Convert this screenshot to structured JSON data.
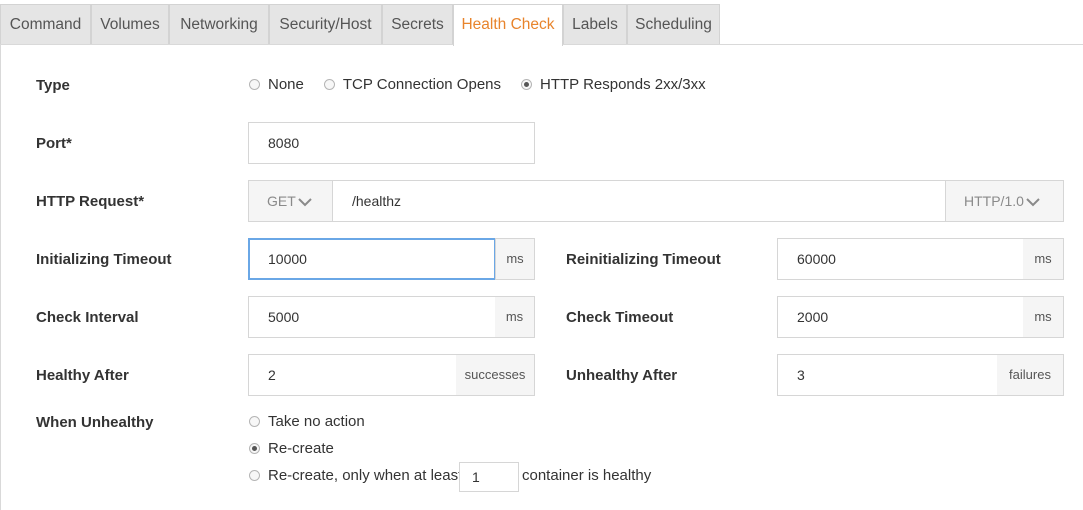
{
  "tabs": [
    {
      "label": "Command"
    },
    {
      "label": "Volumes"
    },
    {
      "label": "Networking"
    },
    {
      "label": "Security/Host"
    },
    {
      "label": "Secrets"
    },
    {
      "label": "Health Check",
      "active": true
    },
    {
      "label": "Labels"
    },
    {
      "label": "Scheduling"
    }
  ],
  "type": {
    "label": "Type",
    "options": [
      "None",
      "TCP Connection Opens",
      "HTTP Responds 2xx/3xx"
    ],
    "selected": "HTTP Responds 2xx/3xx"
  },
  "port": {
    "label": "Port*",
    "value": "8080"
  },
  "http_request": {
    "label": "HTTP Request*",
    "method": "GET",
    "path": "/healthz",
    "version": "HTTP/1.0"
  },
  "initializing_timeout": {
    "label": "Initializing Timeout",
    "value": "10000",
    "unit": "ms"
  },
  "reinitializing_timeout": {
    "label": "Reinitializing Timeout",
    "value": "60000",
    "unit": "ms"
  },
  "check_interval": {
    "label": "Check Interval",
    "value": "5000",
    "unit": "ms"
  },
  "check_timeout": {
    "label": "Check Timeout",
    "value": "2000",
    "unit": "ms"
  },
  "healthy_after": {
    "label": "Healthy After",
    "value": "2",
    "unit": "successes"
  },
  "unhealthy_after": {
    "label": "Unhealthy After",
    "value": "3",
    "unit": "failures"
  },
  "when_unhealthy": {
    "label": "When Unhealthy",
    "options": [
      "Take no action",
      "Re-create",
      "Re-create, only when at least"
    ],
    "selected": "Re-create",
    "min_healthy_value": "1",
    "suffix": "container is healthy"
  },
  "colors": {
    "accent": "#e8842c",
    "focus": "#6aa7e6",
    "tab_bg": "#e5e5e5"
  }
}
